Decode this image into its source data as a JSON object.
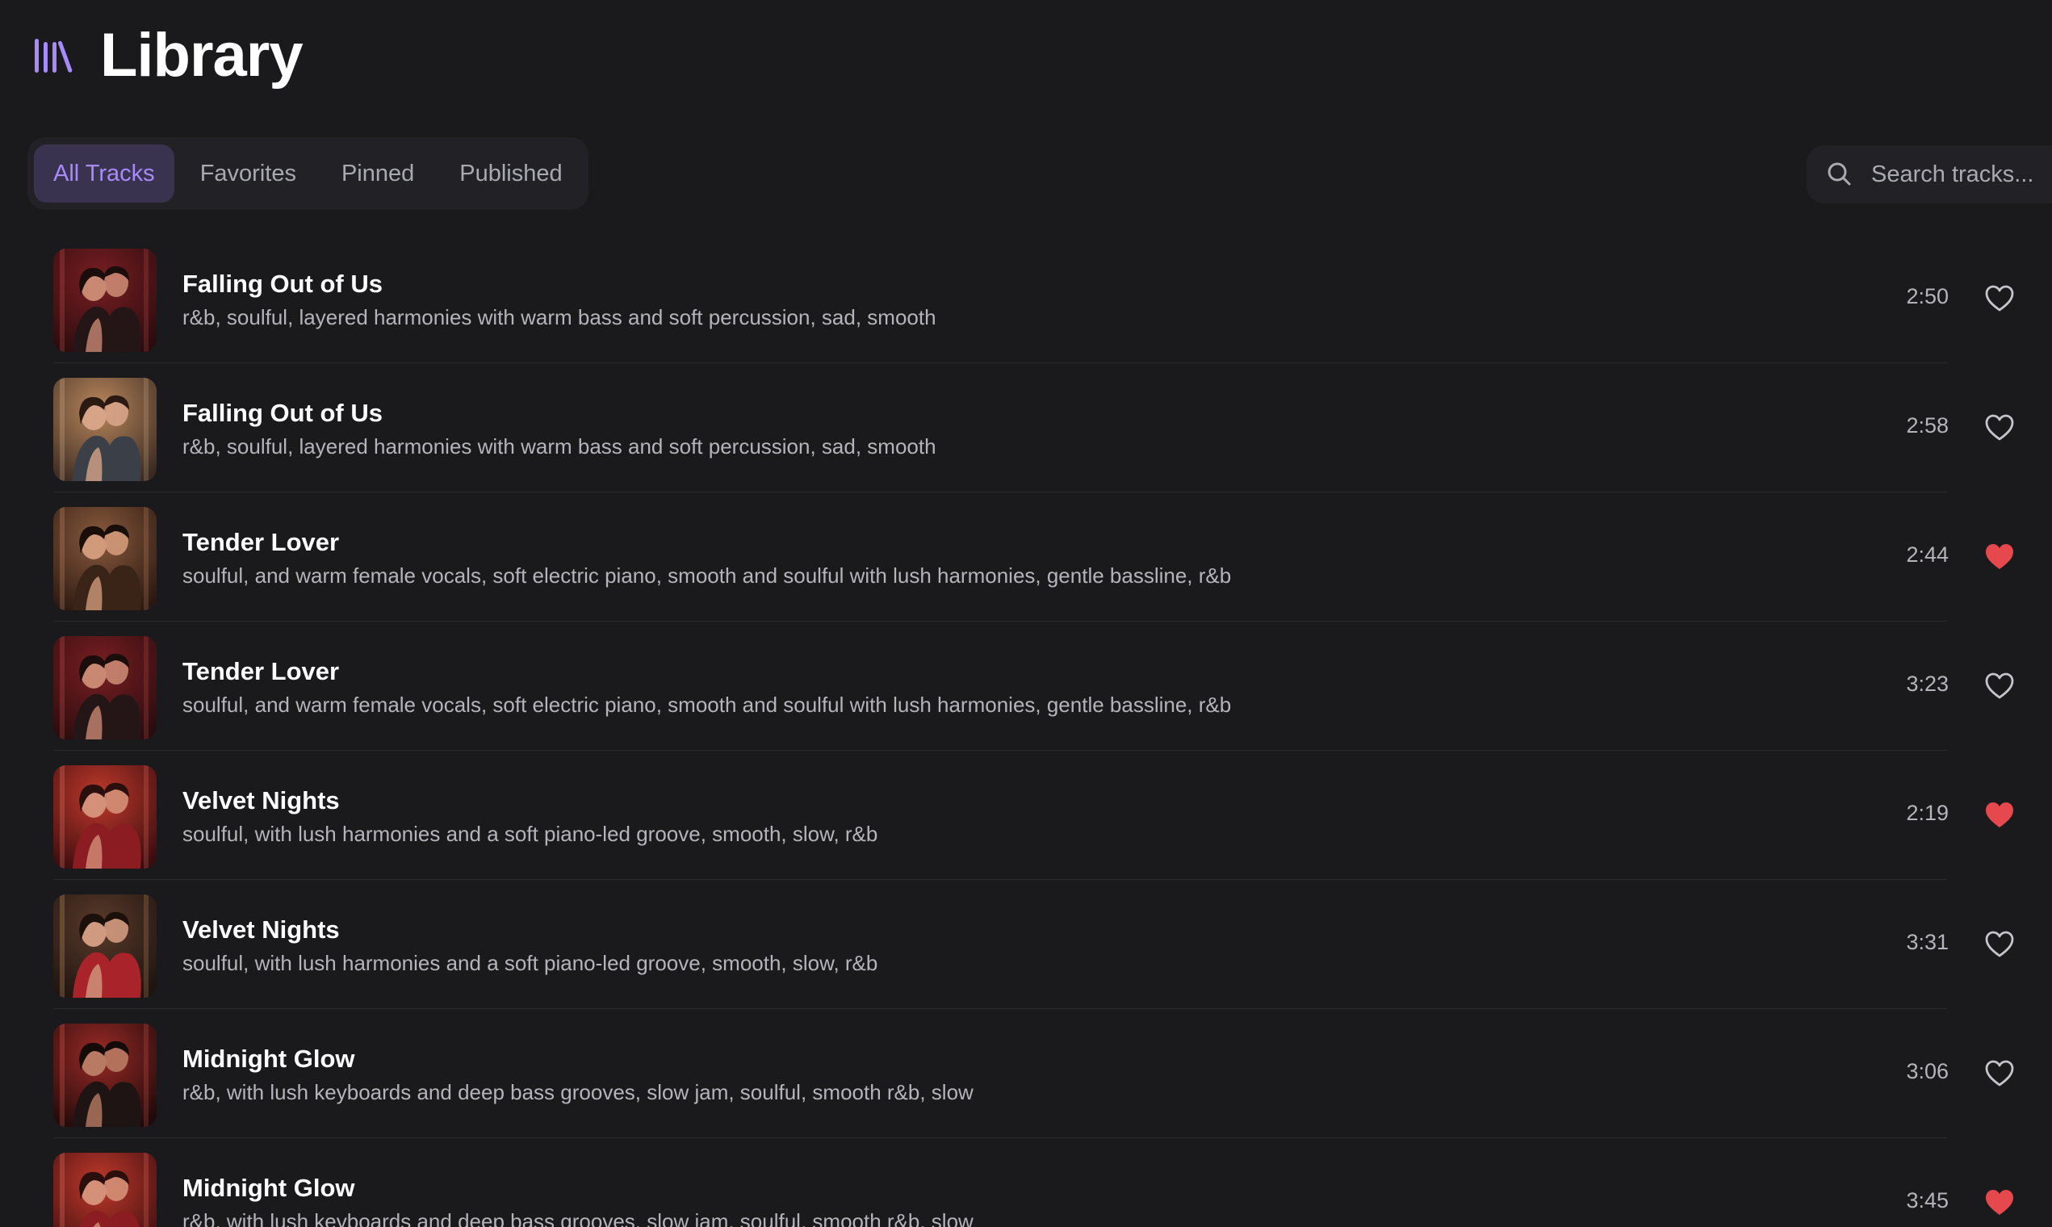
{
  "header": {
    "title": "Library",
    "icon": "library-icon",
    "accent": "#a78bfa"
  },
  "tabs": [
    {
      "label": "All Tracks",
      "active": true
    },
    {
      "label": "Favorites",
      "active": false
    },
    {
      "label": "Pinned",
      "active": false
    },
    {
      "label": "Published",
      "active": false
    }
  ],
  "search": {
    "placeholder": "Search tracks..."
  },
  "colors": {
    "background": "#1a1a1d",
    "favorite": "#e5484d",
    "tab_active_bg": "#3a3350",
    "tab_active_text": "#a78bfa"
  },
  "tracks": [
    {
      "title": "Falling Out of Us",
      "description": "r&b, soulful, layered harmonies with warm bass and soft percussion, sad, smooth",
      "duration": "2:50",
      "favorite": false,
      "cover": "couple-embrace-red"
    },
    {
      "title": "Falling Out of Us",
      "description": "r&b, soulful, layered harmonies with warm bass and soft percussion, sad, smooth",
      "duration": "2:58",
      "favorite": false,
      "cover": "couple-kiss-warm"
    },
    {
      "title": "Tender Lover",
      "description": "soulful, and warm female vocals, soft electric piano, smooth and soulful with lush harmonies, gentle bassline, r&b",
      "duration": "2:44",
      "favorite": true,
      "cover": "couple-kiss-amber"
    },
    {
      "title": "Tender Lover",
      "description": "soulful, and warm female vocals, soft electric piano, smooth and soulful with lush harmonies, gentle bassline, r&b",
      "duration": "3:23",
      "favorite": false,
      "cover": "couple-embrace-red"
    },
    {
      "title": "Velvet Nights",
      "description": "soulful, with lush harmonies and a soft piano-led groove, smooth, slow, r&b",
      "duration": "2:19",
      "favorite": true,
      "cover": "singer-microphone-red"
    },
    {
      "title": "Velvet Nights",
      "description": "soulful, with lush harmonies and a soft piano-led groove, smooth, slow, r&b",
      "duration": "3:31",
      "favorite": false,
      "cover": "guitarist-stage"
    },
    {
      "title": "Midnight Glow",
      "description": "r&b, with lush keyboards and deep bass grooves, slow jam, soulful, smooth r&b, slow",
      "duration": "3:06",
      "favorite": false,
      "cover": "couple-dance-red"
    },
    {
      "title": "Midnight Glow",
      "description": "r&b, with lush keyboards and deep bass grooves, slow jam, soulful, smooth r&b, slow",
      "duration": "3:45",
      "favorite": true,
      "cover": "singer-microphone-red"
    }
  ]
}
